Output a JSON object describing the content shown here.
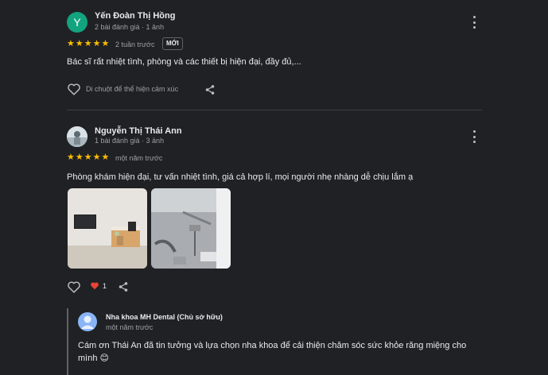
{
  "reviews": [
    {
      "avatar_letter": "Y",
      "avatar_color": "#12a37f",
      "name": "Yến Đoàn Thị Hồng",
      "meta": "2 bài đánh giá · 1 ảnh",
      "rating": 5,
      "when": "2 tuần trước",
      "badge": "MỚI",
      "text": "Bác sĩ rất nhiệt tình, phòng và các thiết bị hiện đại, đầy đủ,...",
      "like_hint": "Di chuột để thể hiện cảm xúc"
    },
    {
      "name": "Nguyễn Thị Thái Ann",
      "meta": "1 bài đánh giá · 3 ảnh",
      "rating": 5,
      "when": "một năm trước",
      "text": "Phòng khám hiện đại, tư vấn nhiệt tình, giá cả hợp lí, mọi người nhẹ nhàng dễ chịu lắm ạ",
      "reaction_count": "1",
      "owner_reply": {
        "name": "Nha khoa MH Dental (Chủ sở hữu)",
        "when": "một năm trước",
        "text_line1": "Cám ơn Thái An đã tin tưởng và lựa chọn nha khoa để cải thiện chăm sóc sức khỏe răng miệng cho",
        "text_line2": "mình 😊"
      }
    }
  ],
  "icons": {
    "star": "star-icon",
    "heart_outline": "heart-outline-icon",
    "heart_filled": "heart-filled-icon",
    "share": "share-icon",
    "more": "more-vert-icon"
  },
  "colors": {
    "background": "#202124",
    "star": "#fbbc04",
    "heart_reaction": "#ea4335",
    "text_primary": "#e8eaed",
    "text_secondary": "#9aa0a6"
  }
}
